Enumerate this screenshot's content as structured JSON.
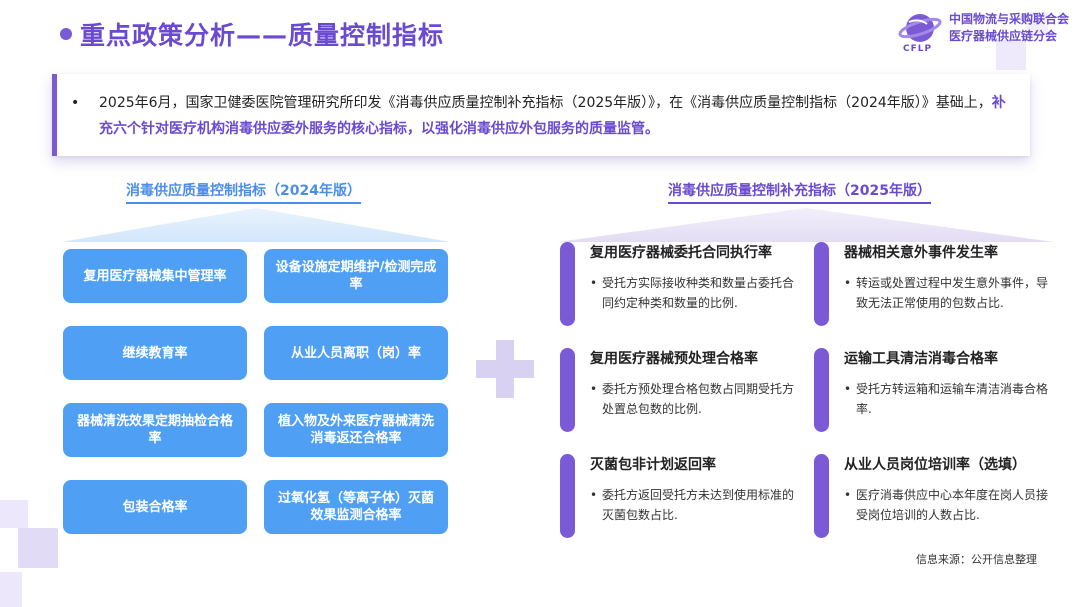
{
  "header": {
    "title": "重点政策分析——质量控制指标"
  },
  "logo": {
    "org_line1": "中国物流与采购联合会",
    "org_line2": "医疗器械供应链分会",
    "caption": "CFLP"
  },
  "intro": {
    "bullet": "•",
    "text_plain": "2025年6月，国家卫健委医院管理研究所印发《消毒供应质量控制补充指标（2025年版）》，在《消毒供应质量控制指标（2024年版）》基础上，",
    "text_emphasis": "补充六个针对医疗机构消毒供应委外服务的核心指标，以强化消毒供应外包服务的质量监管。"
  },
  "left": {
    "heading": "消毒供应质量控制指标（2024年版）",
    "items": [
      "复用医疗器械集中管理率",
      "设备设施定期维护/检测完成率",
      "继续教育率",
      "从业人员离职（岗）率",
      "器械清洗效果定期抽检合格率",
      "植入物及外来医疗器械清洗消毒返还合格率",
      "包装合格率",
      "过氧化氢（等离子体）灭菌效果监测合格率"
    ]
  },
  "right": {
    "heading": "消毒供应质量控制补充指标（2025年版）",
    "cards": [
      {
        "title": "复用医疗器械委托合同执行率",
        "body": "受托方实际接收种类和数量占委托合同约定种类和数量的比例."
      },
      {
        "title": "器械相关意外事件发生率",
        "body": "转运或处置过程中发生意外事件，导致无法正常使用的包数占比."
      },
      {
        "title": "复用医疗器械预处理合格率",
        "body": "委托方预处理合格包数占同期受托方处置总包数的比例."
      },
      {
        "title": "运输工具清洁消毒合格率",
        "body": "受托方转运箱和运输车清洁消毒合格率."
      },
      {
        "title": "灭菌包非计划返回率",
        "body": "委托方返回受托方未达到使用标准的灭菌包数占比."
      },
      {
        "title": "从业人员岗位培训率（选填）",
        "body": "医疗消毒供应中心本年度在岗人员接受岗位培训的人数占比."
      }
    ]
  },
  "footer": {
    "source": "信息来源：公开信息整理"
  },
  "colors": {
    "accent_purple": "#6a4bd0",
    "button_blue": "#4fa0f5",
    "heading_blue": "#4b8ee8",
    "card_bar": "#7b5ad6"
  }
}
